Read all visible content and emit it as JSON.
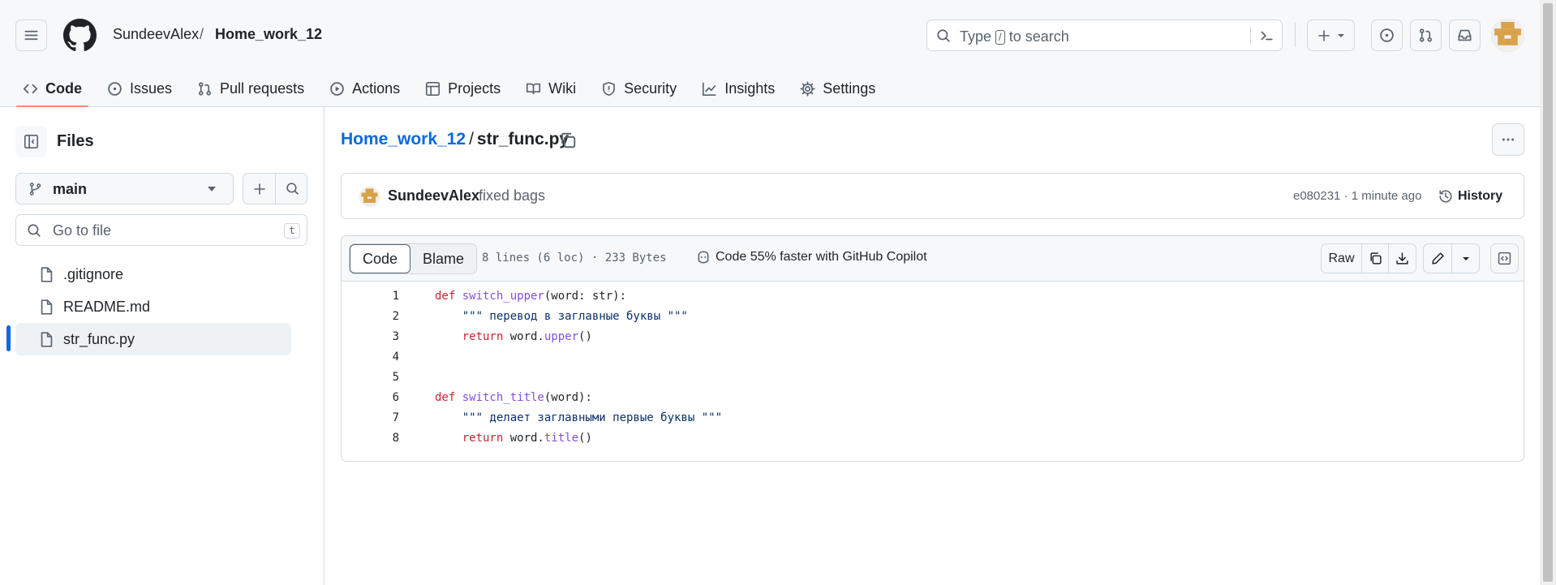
{
  "header": {
    "owner": "SundeevAlex",
    "separator": "/",
    "repo": "Home_work_12",
    "search": {
      "before": "Type",
      "key": "/",
      "after": "to search"
    }
  },
  "nav_tabs": [
    {
      "label": "Code",
      "icon": "code-icon",
      "active": true
    },
    {
      "label": "Issues",
      "icon": "issue-icon"
    },
    {
      "label": "Pull requests",
      "icon": "pull-request-icon"
    },
    {
      "label": "Actions",
      "icon": "play-icon"
    },
    {
      "label": "Projects",
      "icon": "table-icon"
    },
    {
      "label": "Wiki",
      "icon": "book-icon"
    },
    {
      "label": "Security",
      "icon": "shield-icon"
    },
    {
      "label": "Insights",
      "icon": "graph-icon"
    },
    {
      "label": "Settings",
      "icon": "gear-icon"
    }
  ],
  "sidebar": {
    "title": "Files",
    "branch": "main",
    "goto_placeholder": "Go to file",
    "goto_key": "t",
    "files": [
      {
        "name": ".gitignore"
      },
      {
        "name": "README.md"
      },
      {
        "name": "str_func.py",
        "selected": true
      }
    ]
  },
  "breadcrumb": {
    "repo": "Home_work_12",
    "sep": "/",
    "file": "str_func.py"
  },
  "commit": {
    "author": "SundeevAlex",
    "message": "fixed bags",
    "meta": "e080231 · 1 minute ago",
    "history_label": "History"
  },
  "file_header": {
    "code_tab": "Code",
    "blame_tab": "Blame",
    "info": "8 lines (6 loc) · 233 Bytes",
    "copilot": "Code 55% faster with GitHub Copilot",
    "raw_label": "Raw"
  },
  "code_lines": [
    {
      "n": "1",
      "parts": [
        [
          "kw",
          "def "
        ],
        [
          "fn",
          "switch_upper"
        ],
        [
          "",
          "(word: str):"
        ]
      ]
    },
    {
      "n": "2",
      "parts": [
        [
          "st",
          "    \"\"\" перевод в заглавные буквы \"\"\""
        ]
      ]
    },
    {
      "n": "3",
      "parts": [
        [
          "kw",
          "    return "
        ],
        [
          "",
          "word."
        ],
        [
          "fn",
          "upper"
        ],
        [
          "",
          "()"
        ]
      ]
    },
    {
      "n": "4",
      "parts": []
    },
    {
      "n": "5",
      "parts": []
    },
    {
      "n": "6",
      "parts": [
        [
          "kw",
          "def "
        ],
        [
          "fn",
          "switch_title"
        ],
        [
          "",
          "(word):"
        ]
      ]
    },
    {
      "n": "7",
      "parts": [
        [
          "st",
          "    \"\"\" делает заглавными первые буквы \"\"\""
        ]
      ]
    },
    {
      "n": "8",
      "parts": [
        [
          "kw",
          "    return "
        ],
        [
          "",
          "word."
        ],
        [
          "fn",
          "title"
        ],
        [
          "",
          "()"
        ]
      ]
    }
  ],
  "colors": {
    "accent_blue": "#0969da",
    "tab_underline": "#fd8c73",
    "keyword": "#cf222e",
    "function": "#8250df",
    "string": "#0a3069"
  }
}
